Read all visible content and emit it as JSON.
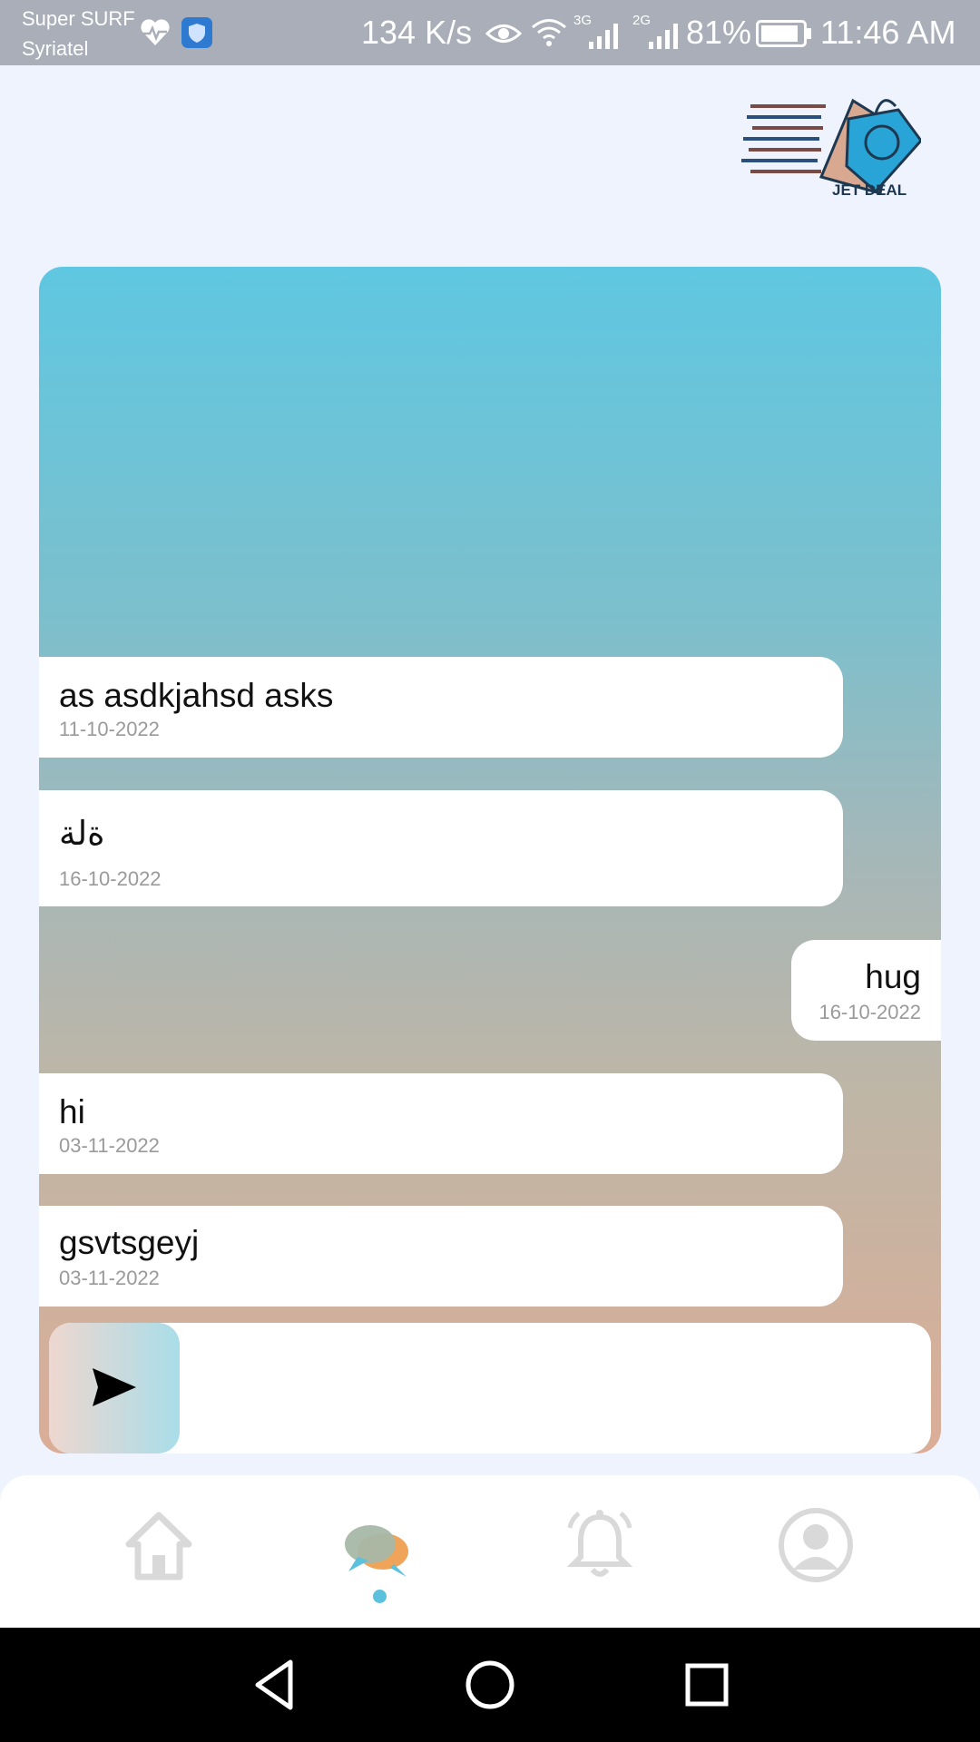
{
  "status_bar": {
    "carrier_1": "Super SURF",
    "carrier_2": "Syriatel",
    "speed": "134 K/s",
    "network_1": "3G",
    "network_2": "2G",
    "battery": "81%",
    "time": "11:46 AM",
    "icons": [
      "heart-rate-icon",
      "shield-app-icon",
      "eye-icon",
      "wifi-icon",
      "signal-icon",
      "battery-icon"
    ]
  },
  "logo": {
    "text": "JET DEAL"
  },
  "messages": [
    {
      "text": "as asdkjahsd asks",
      "date": "11-10-2022",
      "side": "left"
    },
    {
      "text": "ةلة",
      "date": "16-10-2022",
      "side": "left"
    },
    {
      "text": "hug",
      "date": "16-10-2022",
      "side": "right"
    },
    {
      "text": "hi",
      "date": "03-11-2022",
      "side": "left"
    },
    {
      "text": "gsvtsgeyj",
      "date": "03-11-2022",
      "side": "left"
    }
  ],
  "composer": {
    "value": "",
    "send_icon": "send-icon"
  },
  "bottom_nav": {
    "items": [
      {
        "icon": "home-icon",
        "active": false
      },
      {
        "icon": "chat-icon",
        "active": true
      },
      {
        "icon": "bell-icon",
        "active": false
      },
      {
        "icon": "profile-icon",
        "active": false
      }
    ],
    "active_color": "#5bc1dc"
  },
  "system_nav": {
    "icons": [
      "back-icon",
      "home-circle-icon",
      "recents-icon"
    ]
  }
}
